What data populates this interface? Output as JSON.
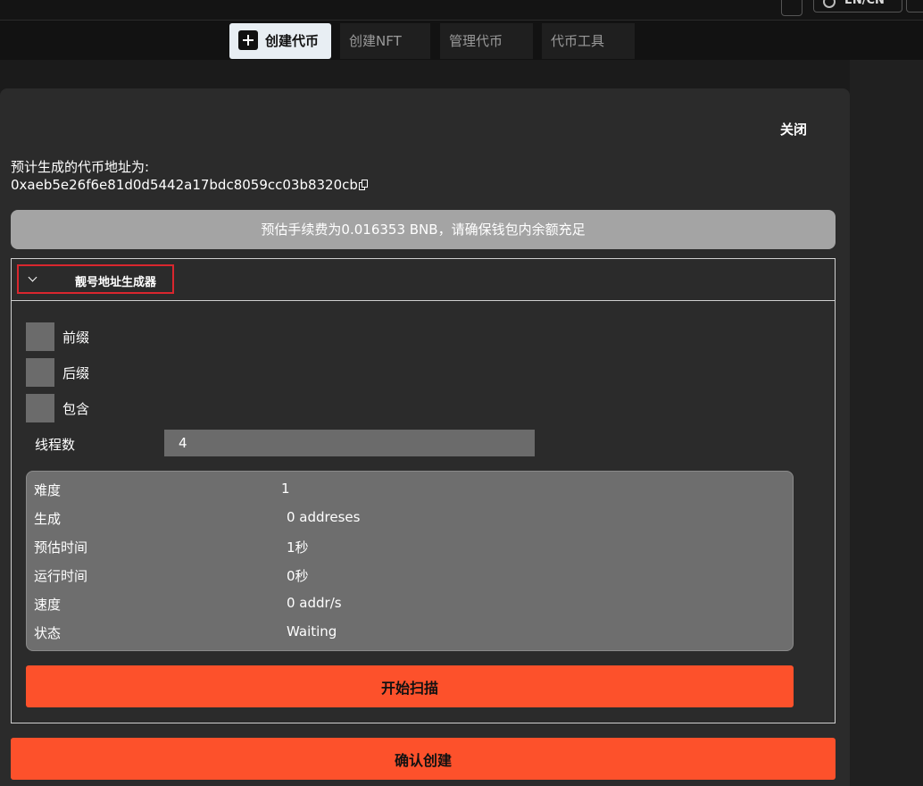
{
  "topbar": {
    "language_label": "EN/CN"
  },
  "tabs": [
    {
      "label": "创建代币",
      "active": true,
      "icon": "plus-square-icon"
    },
    {
      "label": "创建NFT",
      "active": false
    },
    {
      "label": "管理代币",
      "active": false
    },
    {
      "label": "代币工具",
      "active": false
    }
  ],
  "panel": {
    "close_label": "关闭",
    "address_label": "预计生成的代币地址为:",
    "address_value": "0xaeb5e26f6e81d0d5442a17bdc8059cc03b8320cb",
    "fee_notice": "预估手续费为0.016353 BNB，请确保钱包内余额充足",
    "confirm_label": "确认创建"
  },
  "vanity": {
    "title": "靓号地址生成器",
    "options": [
      {
        "label": "前缀",
        "checked": false
      },
      {
        "label": "后缀",
        "checked": false
      },
      {
        "label": "包含",
        "checked": false
      }
    ],
    "threads_label": "线程数",
    "threads_value": "4",
    "stats": [
      {
        "label": "难度",
        "value": "1"
      },
      {
        "label": "生成",
        "value": "0 addreses"
      },
      {
        "label": "预估时间",
        "value": "1秒"
      },
      {
        "label": "运行时间",
        "value": "0秒"
      },
      {
        "label": "速度",
        "value": "0 addr/s"
      },
      {
        "label": "状态",
        "value": "Waiting"
      }
    ],
    "scan_label": "开始扫描"
  },
  "colors": {
    "accent": "#fd512b",
    "panel_bg": "#2b2b2b",
    "fee_bar": "#a4a4a4",
    "stats_bg": "#6e6e6e",
    "highlight_border": "#d9262e"
  }
}
